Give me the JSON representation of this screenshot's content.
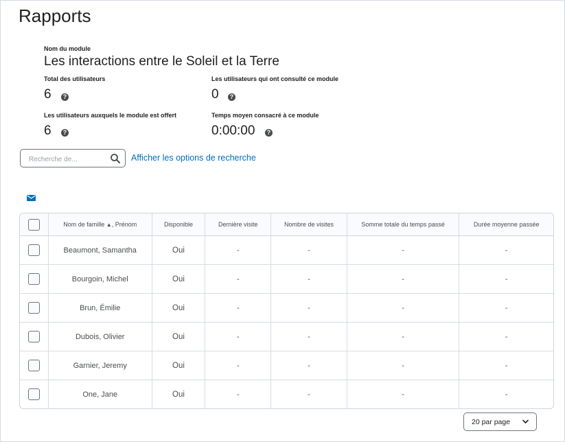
{
  "page": {
    "title": "Rapports"
  },
  "module": {
    "name_label": "Nom du module",
    "name": "Les interactions entre le Soleil et la Terre"
  },
  "stats": {
    "total_users_label": "Total des utilisateurs",
    "total_users": "6",
    "viewed_label": "Les utilisateurs qui ont consulté ce module",
    "viewed": "0",
    "offered_label": "Les utilisateurs auxquels le module est offert",
    "offered": "6",
    "avg_time_label": "Temps moyen consacré à ce module",
    "avg_time": "0:00:00",
    "help_glyph": "?"
  },
  "search": {
    "placeholder": "Recherche de...",
    "value": "",
    "options_link": "Afficher les options de recherche"
  },
  "table": {
    "columns": {
      "lastname": "Nom de famille",
      "sort_indicator": "▲",
      "firstname_sep": ", Prénom",
      "available": "Disponible",
      "last_visit": "Dernière visite",
      "visits": "Nombre de visites",
      "total_time": "Somme totale du temps passé",
      "avg_time": "Durée moyenne passée"
    },
    "rows": [
      {
        "name": "Beaumont, Samantha",
        "available": "Oui",
        "last_visit": "-",
        "visits": "-",
        "total_time": "-",
        "avg_time": "-"
      },
      {
        "name": "Bourgoin, Michel",
        "available": "Oui",
        "last_visit": "-",
        "visits": "-",
        "total_time": "-",
        "avg_time": "-"
      },
      {
        "name": "Brun, Émilie",
        "available": "Oui",
        "last_visit": "-",
        "visits": "-",
        "total_time": "-",
        "avg_time": "-"
      },
      {
        "name": "Dubois, Olivier",
        "available": "Oui",
        "last_visit": "-",
        "visits": "-",
        "total_time": "-",
        "avg_time": "-"
      },
      {
        "name": "Garnier, Jeremy",
        "available": "Oui",
        "last_visit": "-",
        "visits": "-",
        "total_time": "-",
        "avg_time": "-"
      },
      {
        "name": "One, Jane",
        "available": "Oui",
        "last_visit": "-",
        "visits": "-",
        "total_time": "-",
        "avg_time": "-"
      }
    ]
  },
  "pagination": {
    "per_page": "20 par page"
  },
  "icons": {
    "search": "search-icon",
    "email": "email-icon",
    "help": "help-icon",
    "chevron": "chevron-down-icon"
  },
  "colors": {
    "link": "#006fbf",
    "email_icon": "#006fbf",
    "header_bg": "#f9fbff"
  }
}
